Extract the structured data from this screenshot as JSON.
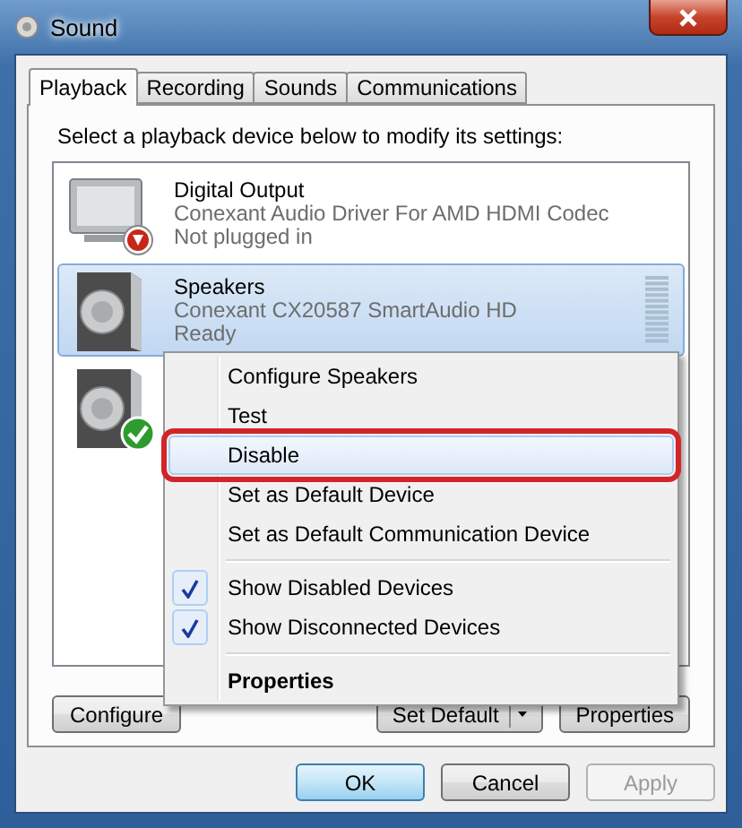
{
  "window": {
    "title": "Sound"
  },
  "tabs": [
    {
      "label": "Playback",
      "selected": true
    },
    {
      "label": "Recording",
      "selected": false
    },
    {
      "label": "Sounds",
      "selected": false
    },
    {
      "label": "Communications",
      "selected": false
    }
  ],
  "instruction": "Select a playback device below to modify its settings:",
  "devices": [
    {
      "kind": "monitor",
      "unplugged": true,
      "default": false,
      "name": "Digital Output",
      "driver": "Conexant Audio Driver For AMD HDMI Codec",
      "status": "Not plugged in",
      "selected": false
    },
    {
      "kind": "speaker",
      "unplugged": false,
      "default": false,
      "name": "Speakers",
      "driver": "Conexant CX20587 SmartAudio HD",
      "status": "Ready",
      "selected": true
    },
    {
      "kind": "speaker",
      "unplugged": false,
      "default": true,
      "selected": false
    }
  ],
  "panel_buttons": [
    {
      "kind": "plain",
      "label": "Configure"
    },
    {
      "kind": "split",
      "label": "Set Default"
    },
    {
      "kind": "plain",
      "label": "Properties"
    }
  ],
  "context_menu": [
    {
      "kind": "item",
      "label": "Configure Speakers",
      "checked": false,
      "selected": false,
      "annotated": false
    },
    {
      "kind": "item",
      "label": "Test",
      "checked": false,
      "selected": false,
      "annotated": false
    },
    {
      "kind": "item",
      "label": "Disable",
      "checked": false,
      "selected": true,
      "annotated": true
    },
    {
      "kind": "item",
      "label": "Set as Default Device",
      "checked": false,
      "selected": false,
      "annotated": false
    },
    {
      "kind": "item",
      "label": "Set as Default Communication Device",
      "checked": false,
      "selected": false,
      "annotated": false
    },
    {
      "kind": "separator"
    },
    {
      "kind": "item",
      "label": "Show Disabled Devices",
      "checked": true,
      "selected": false,
      "annotated": false
    },
    {
      "kind": "item",
      "label": "Show Disconnected Devices",
      "checked": true,
      "selected": false,
      "annotated": false
    },
    {
      "kind": "separator"
    },
    {
      "kind": "default",
      "label": "Properties",
      "checked": false,
      "selected": false,
      "annotated": false
    }
  ],
  "dialog_buttons": [
    {
      "label": "OK",
      "default": true,
      "disabled": false
    },
    {
      "label": "Cancel",
      "default": false,
      "disabled": false
    },
    {
      "label": "Apply",
      "default": false,
      "disabled": true
    }
  ]
}
